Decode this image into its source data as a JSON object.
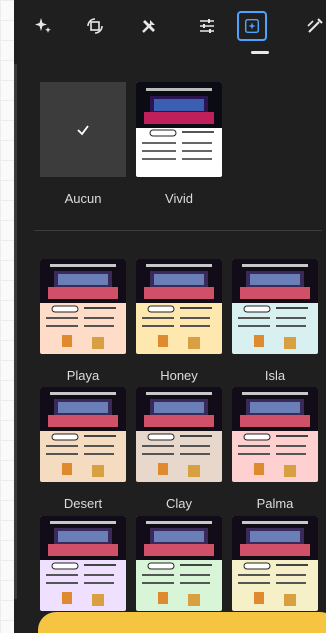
{
  "toolbar": {
    "tools": [
      {
        "name": "sparkle-auto-icon",
        "glyph": "✦"
      },
      {
        "name": "crop-rotate-icon",
        "glyph": "⟳"
      },
      {
        "name": "tools-icon",
        "glyph": "⚒"
      },
      {
        "name": "adjust-sliders-icon",
        "glyph": "☷"
      },
      {
        "name": "filters-icon",
        "glyph": "▣"
      },
      {
        "name": "markup-icon",
        "glyph": "✎"
      }
    ],
    "active_index": 4
  },
  "filters": {
    "top": [
      {
        "label": "Aucun",
        "selected": true
      },
      {
        "label": "Vivid",
        "selected": false
      }
    ],
    "grid": [
      {
        "label": "Playa",
        "tint": "#ffdcc8"
      },
      {
        "label": "Honey",
        "tint": "#ffe8b0"
      },
      {
        "label": "Isla",
        "tint": "#d8f0f0"
      },
      {
        "label": "Desert",
        "tint": "#f5dcc0"
      },
      {
        "label": "Clay",
        "tint": "#e8d8cc"
      },
      {
        "label": "Palma",
        "tint": "#ffd0d0"
      },
      {
        "label": "",
        "tint": "#f0e0ff"
      },
      {
        "label": "",
        "tint": "#d8f5d8"
      },
      {
        "label": "",
        "tint": "#f5f0c8"
      }
    ]
  },
  "colors": {
    "panel_bg": "#1f1f1f",
    "accent_blue": "#4da3ff",
    "action_yellow": "#f5c441"
  }
}
